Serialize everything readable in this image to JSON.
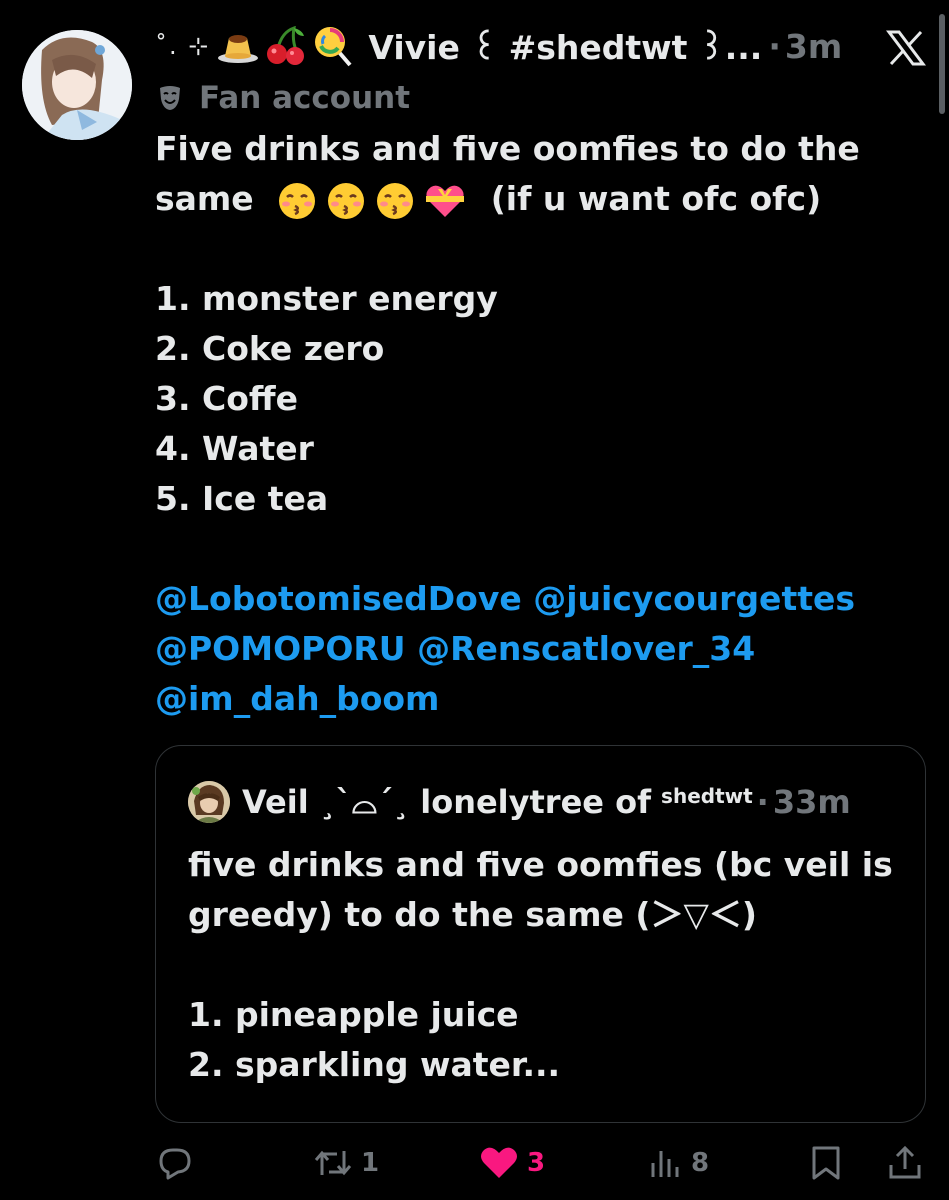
{
  "author": {
    "display_name": "Vivie ꒰ #shedtwt ꒱...",
    "decoration_prefix": "˚. ⊹",
    "decoration_emoji_icons": [
      "flan-icon",
      "cherries-icon",
      "lollipop-icon"
    ],
    "separator": "·",
    "time": "3m",
    "label": "Fan account",
    "label_icon": "theater-masks-icon"
  },
  "tweet": {
    "line1": "Five drinks and five oomfies to do the",
    "line2_prefix": "same",
    "line2_emoji_icons": [
      "kissing-face-icon",
      "kissing-face-icon",
      "kissing-face-icon",
      "heart-with-ribbon-icon"
    ],
    "line2_suffix": "(if u want ofc ofc)",
    "list": [
      "1. monster energy",
      "2. Coke zero",
      "3. Coffe",
      "4. Water",
      "5. Ice tea"
    ],
    "mentions_line1": [
      "@LobotomisedDove",
      "@juicycourgettes"
    ],
    "mentions_line2": [
      "@POMOPORU",
      "@Renscatlover_34"
    ],
    "mentions_line3": [
      "@im_dah_boom"
    ]
  },
  "quote": {
    "display_name": "Veil ¸`⌓´¸ lonelytree of",
    "name_sup": "shedtwt",
    "separator": "·",
    "time": "33m",
    "line1": "five drinks and five oomfies (bc veil is",
    "line2": "greedy) to do the same (＞▽＜)",
    "list": [
      "1. pineapple juice",
      "2. sparkling water..."
    ]
  },
  "actions": {
    "reply_count": "",
    "retweet_count": "1",
    "like_count": "3",
    "views_count": "8"
  },
  "colors": {
    "background": "#000000",
    "text": "#e7e9ea",
    "muted": "#71767b",
    "link": "#1d9bf0",
    "like": "#f91880",
    "border": "#2f3336"
  }
}
